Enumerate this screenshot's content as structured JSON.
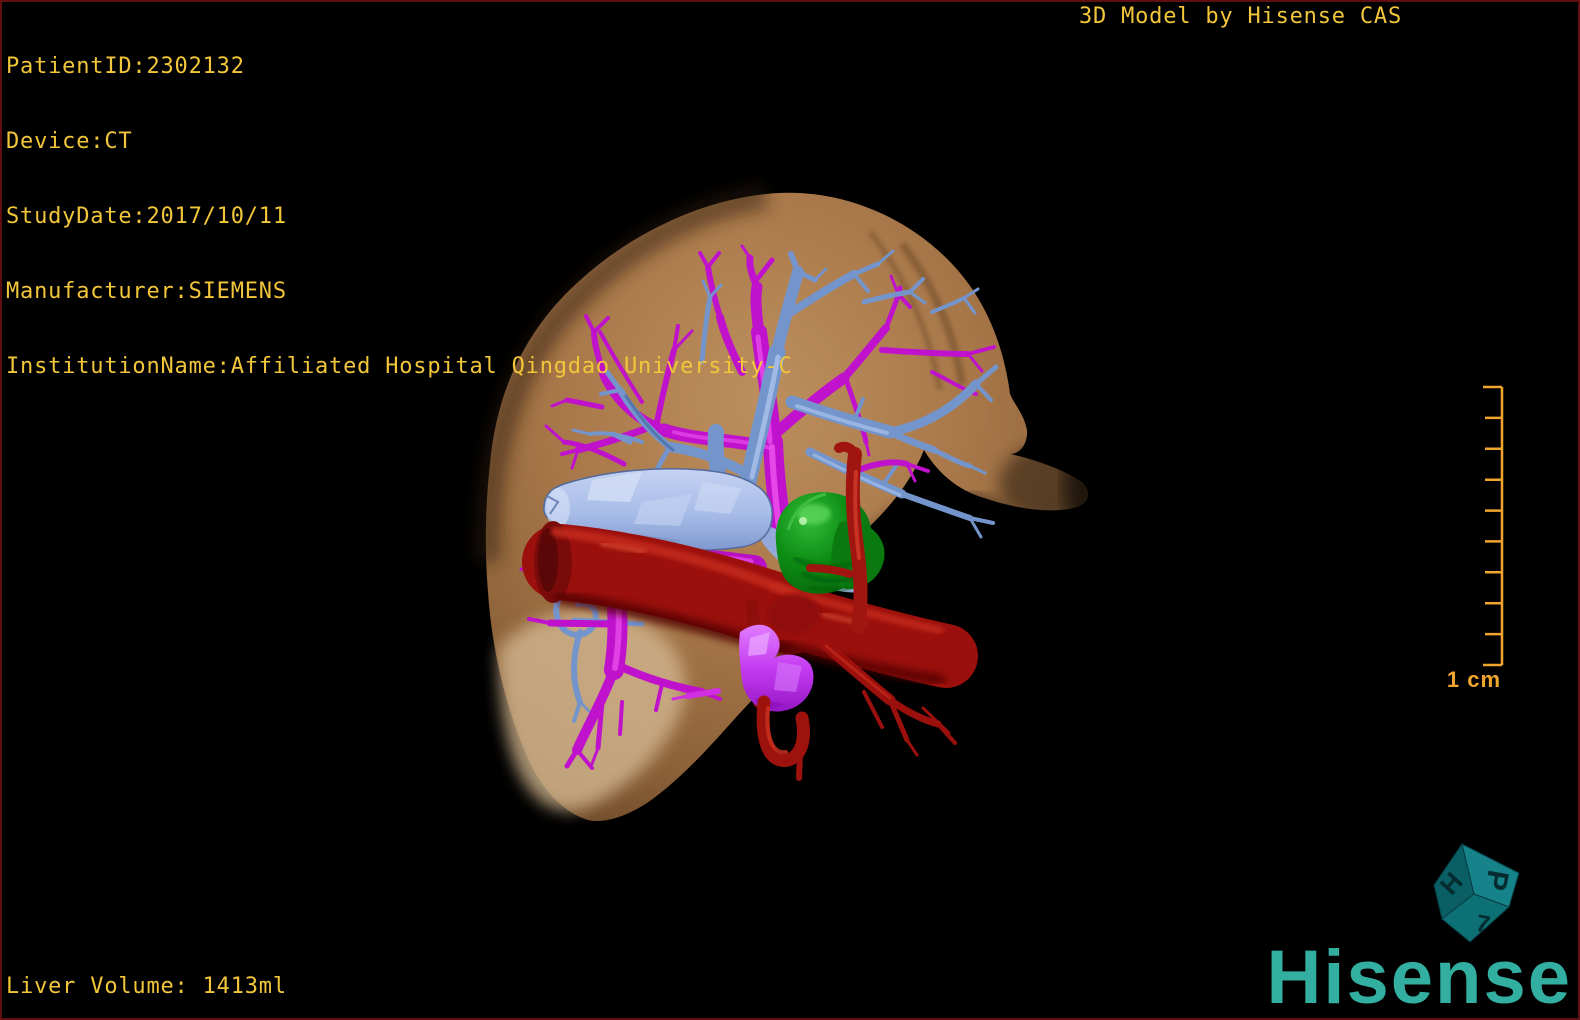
{
  "overlay": {
    "patient_info": [
      "PatientID:2302132",
      "Device:CT",
      "StudyDate:2017/10/11",
      "Manufacturer:SIEMENS",
      "InstitutionName:Affiliated Hospital Qingdao University-C"
    ],
    "title": "3D Model by Hisense CAS",
    "liver_volume": "Liver Volume: 1413ml"
  },
  "scale_bar": {
    "label": "1 cm",
    "tick_count": 10
  },
  "orientation_cube": {
    "face_labels": [
      "H",
      "P",
      "7"
    ]
  },
  "branding": {
    "logo": "Hisense"
  },
  "colors": {
    "background": "#000000",
    "frame_border": "#5f0f0f",
    "overlay_text": "#f2c63a",
    "scale_bar": "#f0a52d",
    "logo_teal": "#32afa0",
    "liver_tan": "#a9784a",
    "hepatic_vein_magenta": "#c012cc",
    "portal_vein_blue": "#7495cc",
    "vena_cava_pale_blue": "#aabeeb",
    "artery_red": "#9b100d",
    "gallbladder_green": "#0a8212",
    "bile_duct_violet": "#c83cfa"
  },
  "model": {
    "structures": [
      {
        "name": "liver",
        "color": "#a9784a"
      },
      {
        "name": "hepatic-veins",
        "color": "#c012cc"
      },
      {
        "name": "portal-vein-branches",
        "color": "#7495cc"
      },
      {
        "name": "inferior-vena-cava",
        "color": "#aabeeb"
      },
      {
        "name": "hepatic-artery-aorta",
        "color": "#9b100d"
      },
      {
        "name": "gallbladder",
        "color": "#0a8212"
      },
      {
        "name": "bile-duct",
        "color": "#c83cfa"
      }
    ]
  }
}
